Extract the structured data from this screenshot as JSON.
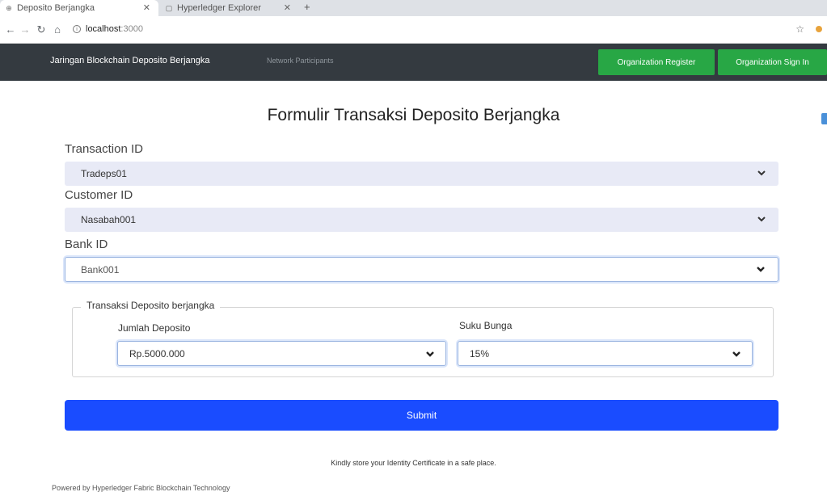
{
  "browser": {
    "tabs": [
      {
        "title": "Deposito Berjangka",
        "active": true
      },
      {
        "title": "Hyperledger Explorer",
        "active": false
      }
    ],
    "url_host": "localhost",
    "url_port": ":3000"
  },
  "navbar": {
    "brand": "Jaringan Blockchain Deposito Berjangka",
    "link": "Network Participants",
    "register_label": "Organization Register",
    "signin_label": "Organization Sign In",
    "button_color": "#28a745",
    "bg_color": "#343a40"
  },
  "form": {
    "title": "Formulir Transaksi Deposito Berjangka",
    "transaction_id_label": "Transaction ID",
    "transaction_id_value": "Tradeps01",
    "customer_id_label": "Customer ID",
    "customer_id_value": "Nasabah001",
    "bank_id_label": "Bank ID",
    "bank_id_value": "Bank001",
    "group_legend": "Transaksi Deposito berjangka",
    "jumlah_label": "Jumlah Deposito",
    "jumlah_value": "Rp.5000.000",
    "suku_label": "Suku Bunga",
    "suku_value": "15%",
    "submit_label": "Submit",
    "submit_color": "#1a4cff",
    "notice": "Kindly store your Identity Certificate in a safe place."
  },
  "footer": "Powered by Hyperledger Fabric Blockchain Technology"
}
